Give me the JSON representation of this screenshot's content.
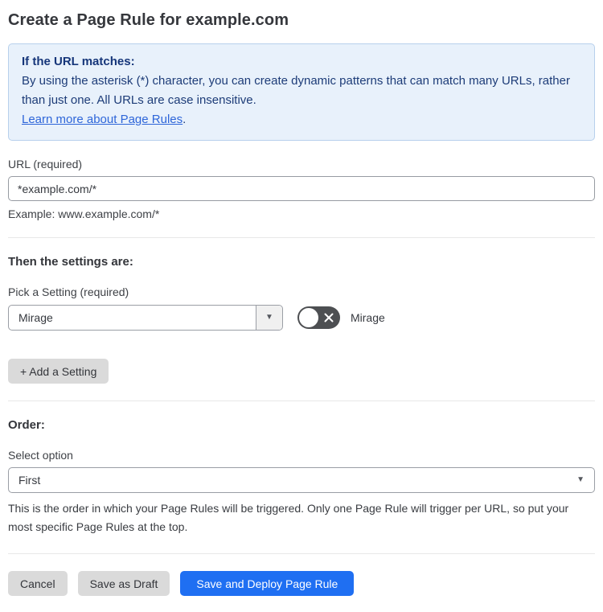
{
  "page": {
    "title": "Create a Page Rule for example.com"
  },
  "info_box": {
    "heading": "If the URL matches:",
    "body": "By using the asterisk (*) character, you can create dynamic patterns that can match many URLs, rather than just one. All URLs are case insensitive.",
    "link_label": "Learn more about Page Rules",
    "link_suffix": "."
  },
  "url_field": {
    "label": "URL (required)",
    "value": "*example.com/*",
    "hint": "Example: www.example.com/*"
  },
  "settings": {
    "heading": "Then the settings are:",
    "picker_label": "Pick a Setting (required)",
    "selected_setting": "Mirage",
    "toggle": {
      "state": "off",
      "label": "Mirage"
    },
    "add_button_label": "+ Add a Setting"
  },
  "order": {
    "heading": "Order:",
    "select_label": "Select option",
    "selected_option": "First",
    "help_text": "This is the order in which your Page Rules will be triggered. Only one Page Rule will trigger per URL, so put your most specific Page Rules at the top."
  },
  "footer": {
    "cancel_label": "Cancel",
    "save_draft_label": "Save as Draft",
    "save_deploy_label": "Save and Deploy Page Rule"
  },
  "icons": {
    "dropdown_arrow": "▼"
  },
  "colors": {
    "accent_blue": "#1f6ff2",
    "info_bg": "#e8f1fb",
    "info_border": "#b7d0ec",
    "info_text": "#1d3c78",
    "link_blue": "#2e66d9",
    "toggle_off_bg": "#4d4f52",
    "button_gray": "#dadada"
  }
}
